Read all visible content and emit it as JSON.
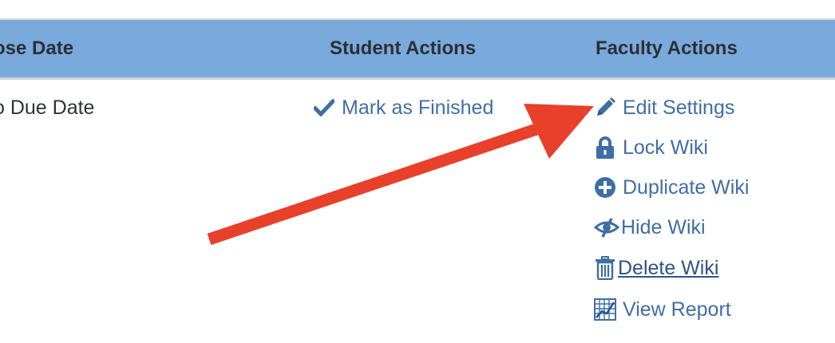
{
  "table": {
    "headers": {
      "close_date": "ose Date",
      "student_actions": "Student Actions",
      "faculty_actions": "Faculty Actions"
    },
    "row": {
      "close_date": "o Due Date",
      "student_actions": [
        {
          "label": "Mark as Finished",
          "icon": "checkmark-icon"
        }
      ],
      "faculty_actions": [
        {
          "label": "Edit Settings",
          "icon": "pencil-icon"
        },
        {
          "label": "Lock Wiki",
          "icon": "lock-icon"
        },
        {
          "label": "Duplicate Wiki",
          "icon": "plus-circle-icon"
        },
        {
          "label": " Hide Wiki",
          "icon": "eye-slash-icon"
        },
        {
          "label": " Delete Wiki",
          "icon": "trash-icon"
        },
        {
          "label": "View Report",
          "icon": "report-grid-icon"
        }
      ]
    }
  },
  "colors": {
    "header_bg": "#7aa9dc",
    "link": "#3f6ea5",
    "arrow": "#e8402a"
  }
}
